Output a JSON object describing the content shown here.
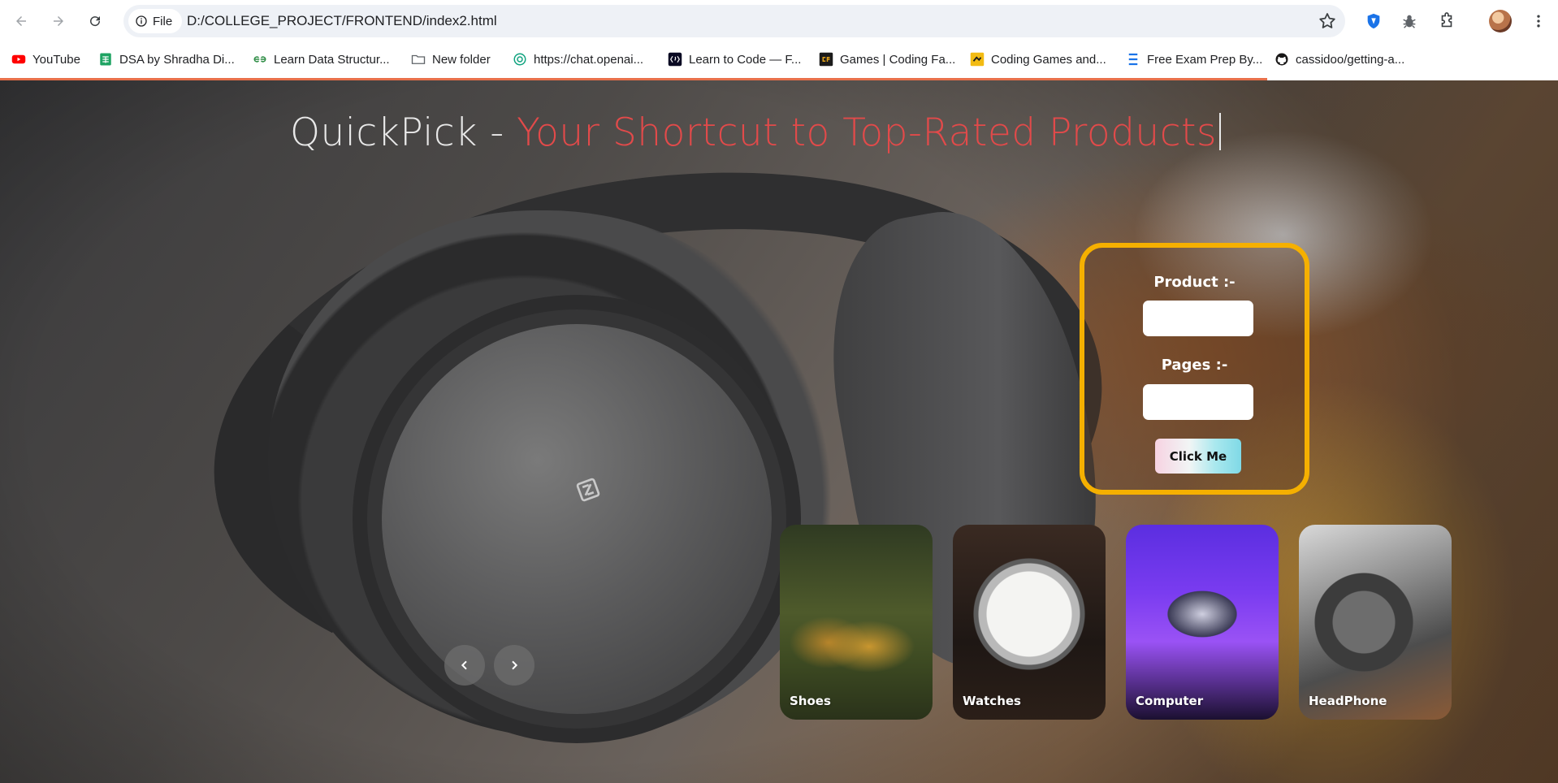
{
  "browser": {
    "chip_label": "File",
    "url": "D:/COLLEGE_PROJECT/FRONTEND/index2.html",
    "bookmarks": [
      {
        "label": "YouTube",
        "icon": "youtube-icon",
        "color": "#ff0000"
      },
      {
        "label": "DSA by Shradha Di...",
        "icon": "sheets-icon",
        "color": "#1ea362"
      },
      {
        "label": "Learn Data Structur...",
        "icon": "gfg-icon",
        "color": "#2f8d46"
      },
      {
        "label": "New folder",
        "icon": "folder-icon",
        "color": "#5f6368"
      },
      {
        "label": "https://chat.openai...",
        "icon": "openai-icon",
        "color": "#10a37f"
      },
      {
        "label": "Learn to Code — F...",
        "icon": "freecodecamp-icon",
        "color": "#0a0a23"
      },
      {
        "label": "Games | Coding Fa...",
        "icon": "codingfantasy-icon",
        "color": "#1b1b1b"
      },
      {
        "label": "Coding Games and...",
        "icon": "codingame-icon",
        "color": "#f2bb13"
      },
      {
        "label": "Free Exam Prep By...",
        "icon": "examprep-icon",
        "color": "#1a73e8"
      },
      {
        "label": "cassidoo/getting-a...",
        "icon": "github-icon",
        "color": "#181717"
      }
    ]
  },
  "page": {
    "headline_brand": "QuickPick - ",
    "headline_tag": "Your Shortcut to Top-Rated Products",
    "form": {
      "product_label": "Product :-",
      "pages_label": "Pages :-",
      "product_value": "",
      "pages_value": "",
      "button_label": "Click Me"
    },
    "categories": [
      "Shoes",
      "Watches",
      "Computer",
      "HeadPhone"
    ],
    "colors": {
      "accent_red": "#e24a4a",
      "form_border": "#f5b000",
      "load_bar": "#e8704a"
    }
  }
}
